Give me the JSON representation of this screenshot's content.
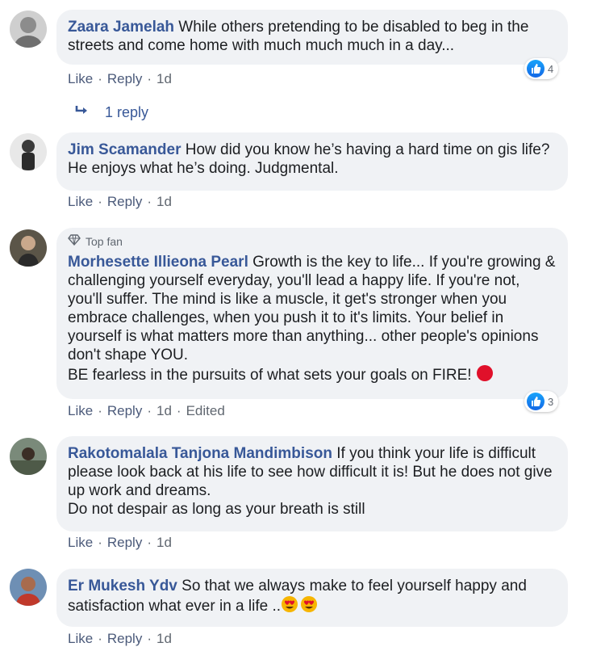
{
  "comments": [
    {
      "author": "Zaara Jamelah",
      "text": " While others pretending to be disabled to beg in the streets and come home with much much much in a day...",
      "actions": {
        "like": "Like",
        "reply": "Reply",
        "time": "1d"
      },
      "reaction_count": "4",
      "reply_count_label": "1 reply"
    },
    {
      "author": "Jim Scamander",
      "text": " How did you know he’s having a hard time on gis life? He enjoys what he’s doing. Judgmental.",
      "actions": {
        "like": "Like",
        "reply": "Reply",
        "time": "1d"
      }
    },
    {
      "badge": "Top fan",
      "author": "Morhesette Illieona Pearl",
      "text": " Growth is the key to life... If you're growing & challenging yourself everyday, you'll lead a happy life. If you're not, you'll suffer. The mind is like a muscle, it get's stronger when you embrace challenges, when you push it to it's limits. Your belief in yourself is what matters more than anything... other people's opinions don't shape YOU.\nBE fearless in the pursuits of what sets your goals on FIRE! ",
      "actions": {
        "like": "Like",
        "reply": "Reply",
        "time": "1d",
        "edited": "Edited"
      },
      "reaction_count": "3"
    },
    {
      "author": "Rakotomalala Tanjona Mandimbison",
      "text": " If you think your life is difficult please look back at his life to see how difficult it is! But he does not give up work and dreams.\nDo not despair as long as your breath is still",
      "actions": {
        "like": "Like",
        "reply": "Reply",
        "time": "1d"
      }
    },
    {
      "author": "Er Mukesh Ydv",
      "text": " So that we always make to feel yourself happy and satisfaction what ever in a life ..",
      "actions": {
        "like": "Like",
        "reply": "Reply",
        "time": "1d"
      }
    }
  ],
  "colors": {
    "author": "#385898",
    "bubble": "#f0f2f5",
    "meta": "#606770",
    "like_blue": "#1877f2",
    "red_circle": "#e0102a"
  },
  "icons": [
    "like-icon",
    "reply-arrow-icon",
    "diamond-icon",
    "red-circle-icon",
    "heart-eyes-emoji-icon"
  ]
}
